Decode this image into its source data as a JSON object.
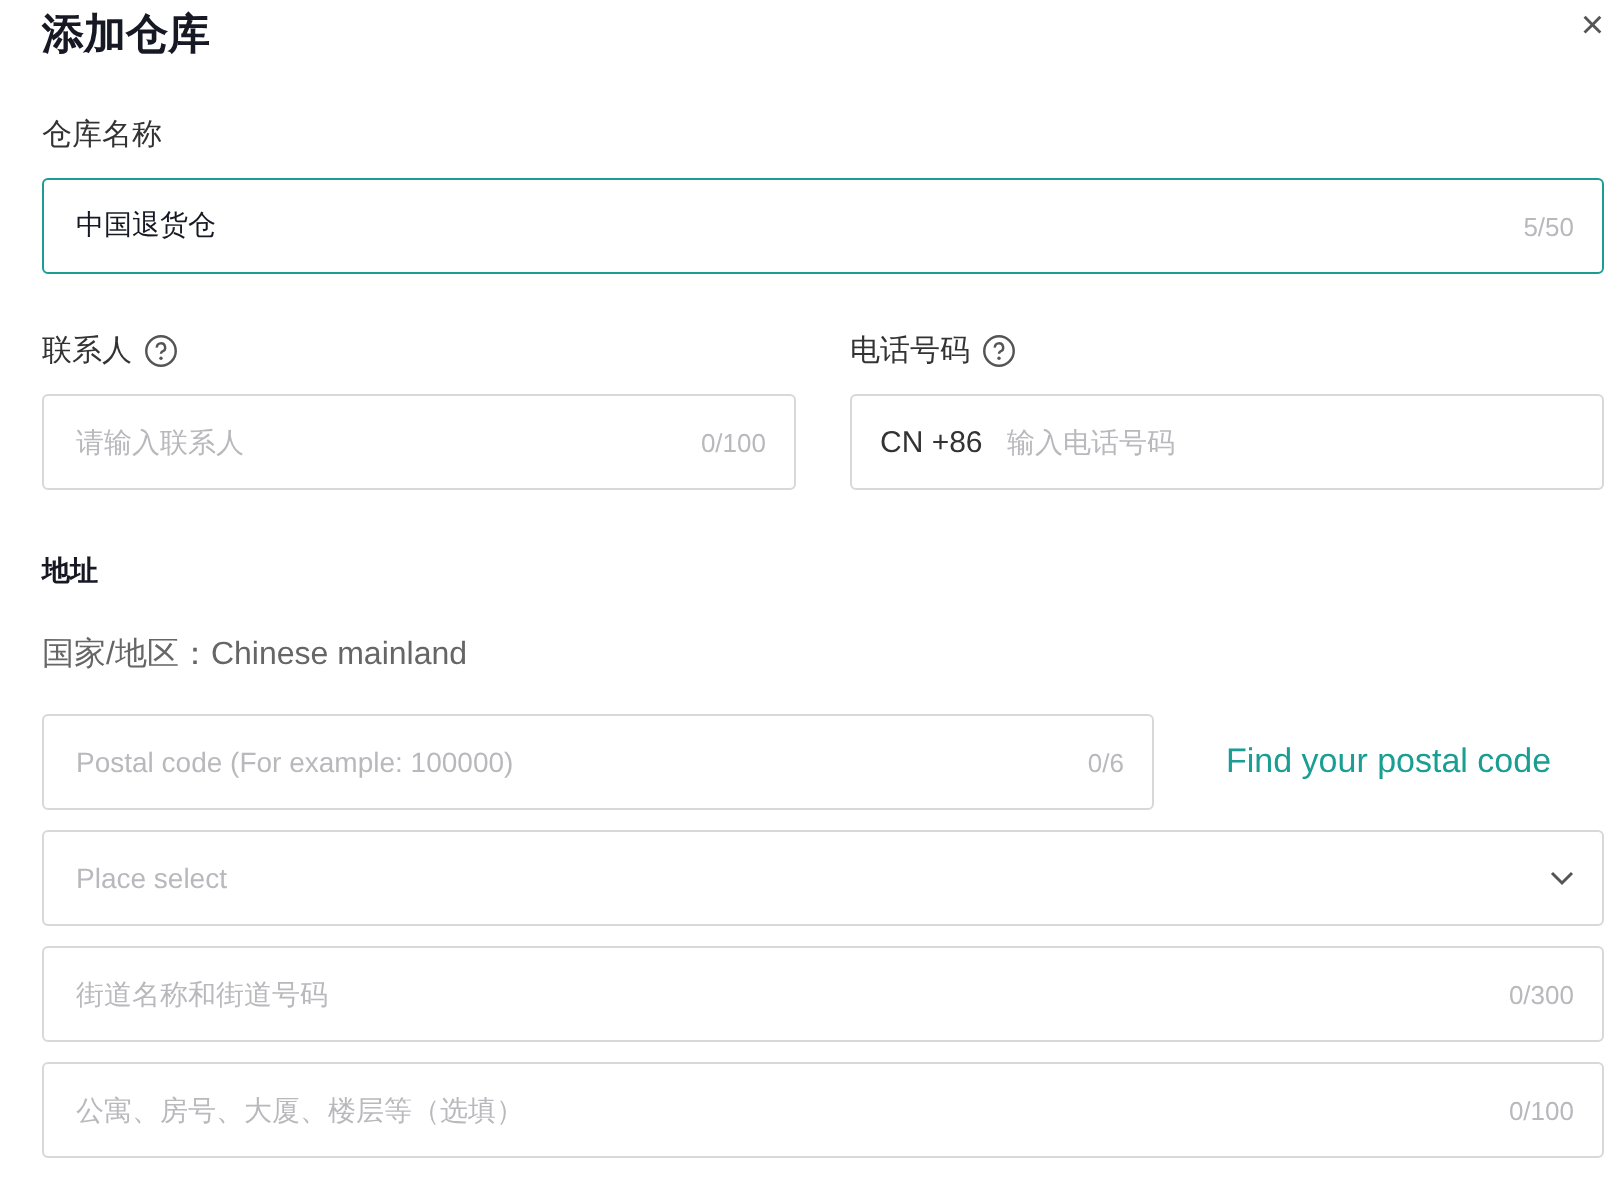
{
  "title": "添加仓库",
  "close": "×",
  "name_field": {
    "label": "仓库名称",
    "value": "中国退货仓",
    "counter": "5/50",
    "focused": true
  },
  "contact_field": {
    "label": "联系人",
    "placeholder": "请输入联系人",
    "counter": "0/100"
  },
  "phone_field": {
    "label": "电话号码",
    "prefix": "CN +86",
    "placeholder": "输入电话号码"
  },
  "address": {
    "heading": "地址",
    "region_label": "国家/地区：",
    "region_value": "Chinese mainland",
    "postal": {
      "placeholder": "Postal code (For example: 100000)",
      "counter": "0/6"
    },
    "postal_link": "Find your postal code",
    "select": {
      "placeholder": "Place select"
    },
    "street": {
      "placeholder": "街道名称和街道号码",
      "counter": "0/300"
    },
    "apartment": {
      "placeholder": "公寓、房号、大厦、楼层等（选填）",
      "counter": "0/100"
    }
  }
}
